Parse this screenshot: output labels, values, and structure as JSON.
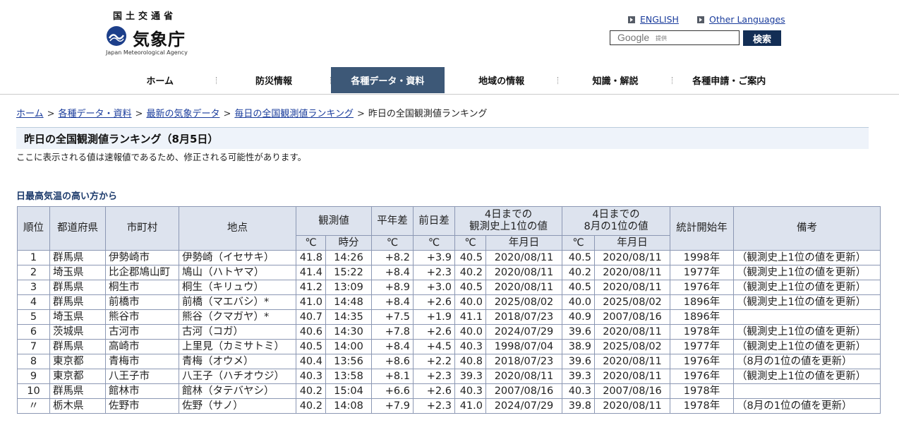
{
  "header": {
    "logo_ministry": "国土交通省",
    "logo_agency": "気象庁",
    "logo_english": "Japan Meteorological Agency",
    "lang_english": "ENGLISH",
    "lang_other": "Other Languages",
    "search_placeholder_brand": "Google",
    "search_placeholder_suffix": "提供",
    "search_button": "検索",
    "accent_color": "#132e55"
  },
  "nav": {
    "items": [
      {
        "label": "ホーム"
      },
      {
        "label": "防災情報"
      },
      {
        "label": "各種データ・資料"
      },
      {
        "label": "地域の情報"
      },
      {
        "label": "知識・解説"
      },
      {
        "label": "各種申請・ご案内"
      }
    ],
    "active_index": 2,
    "active_color": "#3d5877"
  },
  "breadcrumb": {
    "items": [
      "ホーム",
      "各種データ・資料",
      "最新の気象データ",
      "毎日の全国観測値ランキング"
    ],
    "current": "昨日の全国観測値ランキング"
  },
  "page": {
    "title": "昨日の全国観測値ランキング（8月5日）",
    "notice": "ここに表示される値は速報値であるため、修正される可能性があります。",
    "section_title": "日最高気温の高い方から"
  },
  "table": {
    "headers": {
      "rank": "順位",
      "pref": "都道府県",
      "city": "市町村",
      "point": "地点",
      "obs": "観測値",
      "normal_diff": "平年差",
      "prev_diff": "前日差",
      "record_all_1": "4日までの",
      "record_all_2": "観測史上1位の値",
      "record_aug_1": "4日までの",
      "record_aug_2": "8月の1位の値",
      "start_year": "統計開始年",
      "remarks": "備考",
      "deg": "℃",
      "time": "時分",
      "date": "年月日"
    },
    "rows": [
      {
        "rank": "1",
        "pref": "群馬県",
        "city": "伊勢崎市",
        "point": "伊勢崎（イセサキ）",
        "temp": "41.8",
        "time": "14:26",
        "normal": "+8.2",
        "prev": "+3.9",
        "rec_all": "40.5",
        "rec_all_date": "2020/08/11",
        "rec_aug": "40.5",
        "rec_aug_date": "2020/08/11",
        "start": "1998年",
        "remark": "（観測史上1位の値を更新）"
      },
      {
        "rank": "2",
        "pref": "埼玉県",
        "city": "比企郡鳩山町",
        "point": "鳩山（ハトヤマ）",
        "temp": "41.4",
        "time": "15:22",
        "normal": "+8.4",
        "prev": "+2.3",
        "rec_all": "40.2",
        "rec_all_date": "2020/08/11",
        "rec_aug": "40.2",
        "rec_aug_date": "2020/08/11",
        "start": "1977年",
        "remark": "（観測史上1位の値を更新）"
      },
      {
        "rank": "3",
        "pref": "群馬県",
        "city": "桐生市",
        "point": "桐生（キリュウ）",
        "temp": "41.2",
        "time": "13:09",
        "normal": "+8.9",
        "prev": "+3.0",
        "rec_all": "40.5",
        "rec_all_date": "2020/08/11",
        "rec_aug": "40.5",
        "rec_aug_date": "2020/08/11",
        "start": "1976年",
        "remark": "（観測史上1位の値を更新）"
      },
      {
        "rank": "4",
        "pref": "群馬県",
        "city": "前橋市",
        "point": "前橋（マエバシ）*",
        "temp": "41.0",
        "time": "14:48",
        "normal": "+8.4",
        "prev": "+2.6",
        "rec_all": "40.0",
        "rec_all_date": "2025/08/02",
        "rec_aug": "40.0",
        "rec_aug_date": "2025/08/02",
        "start": "1896年",
        "remark": "（観測史上1位の値を更新）"
      },
      {
        "rank": "5",
        "pref": "埼玉県",
        "city": "熊谷市",
        "point": "熊谷（クマガヤ）*",
        "temp": "40.7",
        "time": "14:35",
        "normal": "+7.5",
        "prev": "+1.9",
        "rec_all": "41.1",
        "rec_all_date": "2018/07/23",
        "rec_aug": "40.9",
        "rec_aug_date": "2007/08/16",
        "start": "1896年",
        "remark": ""
      },
      {
        "rank": "6",
        "pref": "茨城県",
        "city": "古河市",
        "point": "古河（コガ）",
        "temp": "40.6",
        "time": "14:30",
        "normal": "+7.8",
        "prev": "+2.6",
        "rec_all": "40.0",
        "rec_all_date": "2024/07/29",
        "rec_aug": "39.6",
        "rec_aug_date": "2020/08/11",
        "start": "1978年",
        "remark": "（観測史上1位の値を更新）"
      },
      {
        "rank": "7",
        "pref": "群馬県",
        "city": "高崎市",
        "point": "上里見（カミサトミ）",
        "temp": "40.5",
        "time": "14:00",
        "normal": "+8.4",
        "prev": "+4.5",
        "rec_all": "40.3",
        "rec_all_date": "1998/07/04",
        "rec_aug": "38.9",
        "rec_aug_date": "2025/08/02",
        "start": "1977年",
        "remark": "（観測史上1位の値を更新）"
      },
      {
        "rank": "8",
        "pref": "東京都",
        "city": "青梅市",
        "point": "青梅（オウメ）",
        "temp": "40.4",
        "time": "13:56",
        "normal": "+8.6",
        "prev": "+2.2",
        "rec_all": "40.8",
        "rec_all_date": "2018/07/23",
        "rec_aug": "39.6",
        "rec_aug_date": "2020/08/11",
        "start": "1976年",
        "remark": "（8月の1位の値を更新）"
      },
      {
        "rank": "9",
        "pref": "東京都",
        "city": "八王子市",
        "point": "八王子（ハチオウジ）",
        "temp": "40.3",
        "time": "13:58",
        "normal": "+8.1",
        "prev": "+2.3",
        "rec_all": "39.3",
        "rec_all_date": "2020/08/11",
        "rec_aug": "39.3",
        "rec_aug_date": "2020/08/11",
        "start": "1976年",
        "remark": "（観測史上1位の値を更新）"
      },
      {
        "rank": "10",
        "pref": "群馬県",
        "city": "館林市",
        "point": "館林（タテバヤシ）",
        "temp": "40.2",
        "time": "15:04",
        "normal": "+6.6",
        "prev": "+2.6",
        "rec_all": "40.3",
        "rec_all_date": "2007/08/16",
        "rec_aug": "40.3",
        "rec_aug_date": "2007/08/16",
        "start": "1978年",
        "remark": ""
      },
      {
        "rank": "〃",
        "pref": "栃木県",
        "city": "佐野市",
        "point": "佐野（サノ）",
        "temp": "40.2",
        "time": "14:08",
        "normal": "+7.9",
        "prev": "+2.3",
        "rec_all": "41.0",
        "rec_all_date": "2024/07/29",
        "rec_aug": "39.8",
        "rec_aug_date": "2020/08/11",
        "start": "1978年",
        "remark": "（8月の1位の値を更新）"
      }
    ]
  }
}
